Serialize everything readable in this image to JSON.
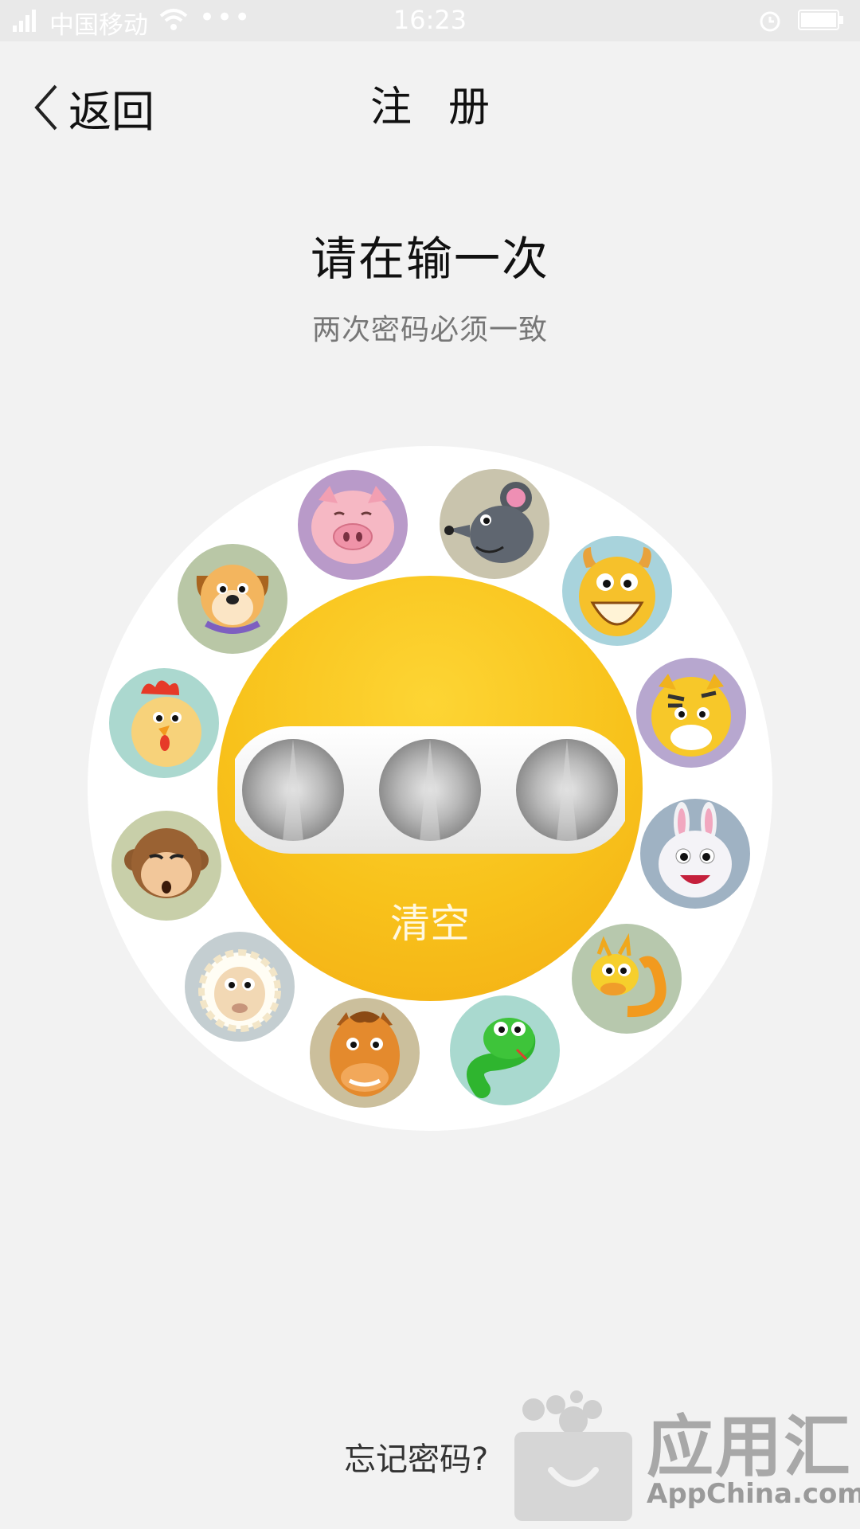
{
  "status_bar": {
    "carrier": "中国移动",
    "dots": "•••",
    "time": "16:23"
  },
  "nav": {
    "back_label": "返回",
    "title": "注册"
  },
  "prompt": {
    "title": "请在输一次",
    "subtitle": "两次密码必须一致"
  },
  "zodiac_icons": [
    "pig-icon",
    "rat-icon",
    "ox-icon",
    "tiger-icon",
    "rabbit-icon",
    "dragon-icon",
    "snake-icon",
    "horse-icon",
    "goat-icon",
    "monkey-icon",
    "rooster-icon",
    "dog-icon"
  ],
  "center": {
    "filled_slots": 0,
    "total_slots": 3,
    "clear_label": "清空"
  },
  "footer": {
    "forgot_label": "忘记密码?"
  },
  "watermark": {
    "brand": "应用汇",
    "domain": "AppChina.com"
  },
  "colors": {
    "accent": "#f8c21b",
    "background": "#f2f2f2"
  }
}
